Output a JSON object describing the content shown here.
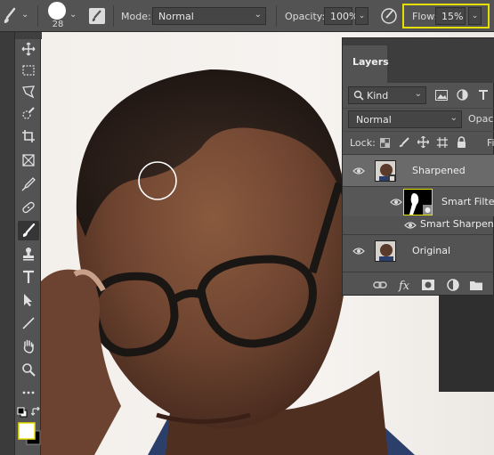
{
  "options_bar": {
    "brush_size": "28",
    "mode_label": "Mode:",
    "mode_value": "Normal",
    "opacity_label": "Opacity:",
    "opacity_value": "100%",
    "flow_label": "Flow:",
    "flow_value": "15%",
    "highlight_color": "#e6e000"
  },
  "toolbar": {
    "tools": [
      "move-icon",
      "marquee-icon",
      "lasso-icon",
      "quick-select-icon",
      "crop-icon",
      "frame-icon",
      "eyedropper-icon",
      "healing-icon",
      "brush-icon",
      "stamp-icon",
      "type-icon",
      "path-select-icon",
      "line-icon",
      "hand-icon",
      "zoom-icon",
      "more-tools-icon"
    ],
    "active_tool": "brush-icon",
    "foreground_color": "#ffffff",
    "background_color": "#000000"
  },
  "layers_panel": {
    "tab_label": "Layers",
    "filter_kind": "Kind",
    "blend_mode": "Normal",
    "opacity_label": "Opacit",
    "lock_label": "Lock:",
    "fill_label": "Fi",
    "layers": [
      {
        "name": "Sharpened",
        "selected": true
      },
      {
        "name": "Smart Filters",
        "type": "smart-filter-mask"
      },
      {
        "name": "Smart Sharpen",
        "type": "filter"
      },
      {
        "name": "Original",
        "selected": false
      }
    ]
  }
}
